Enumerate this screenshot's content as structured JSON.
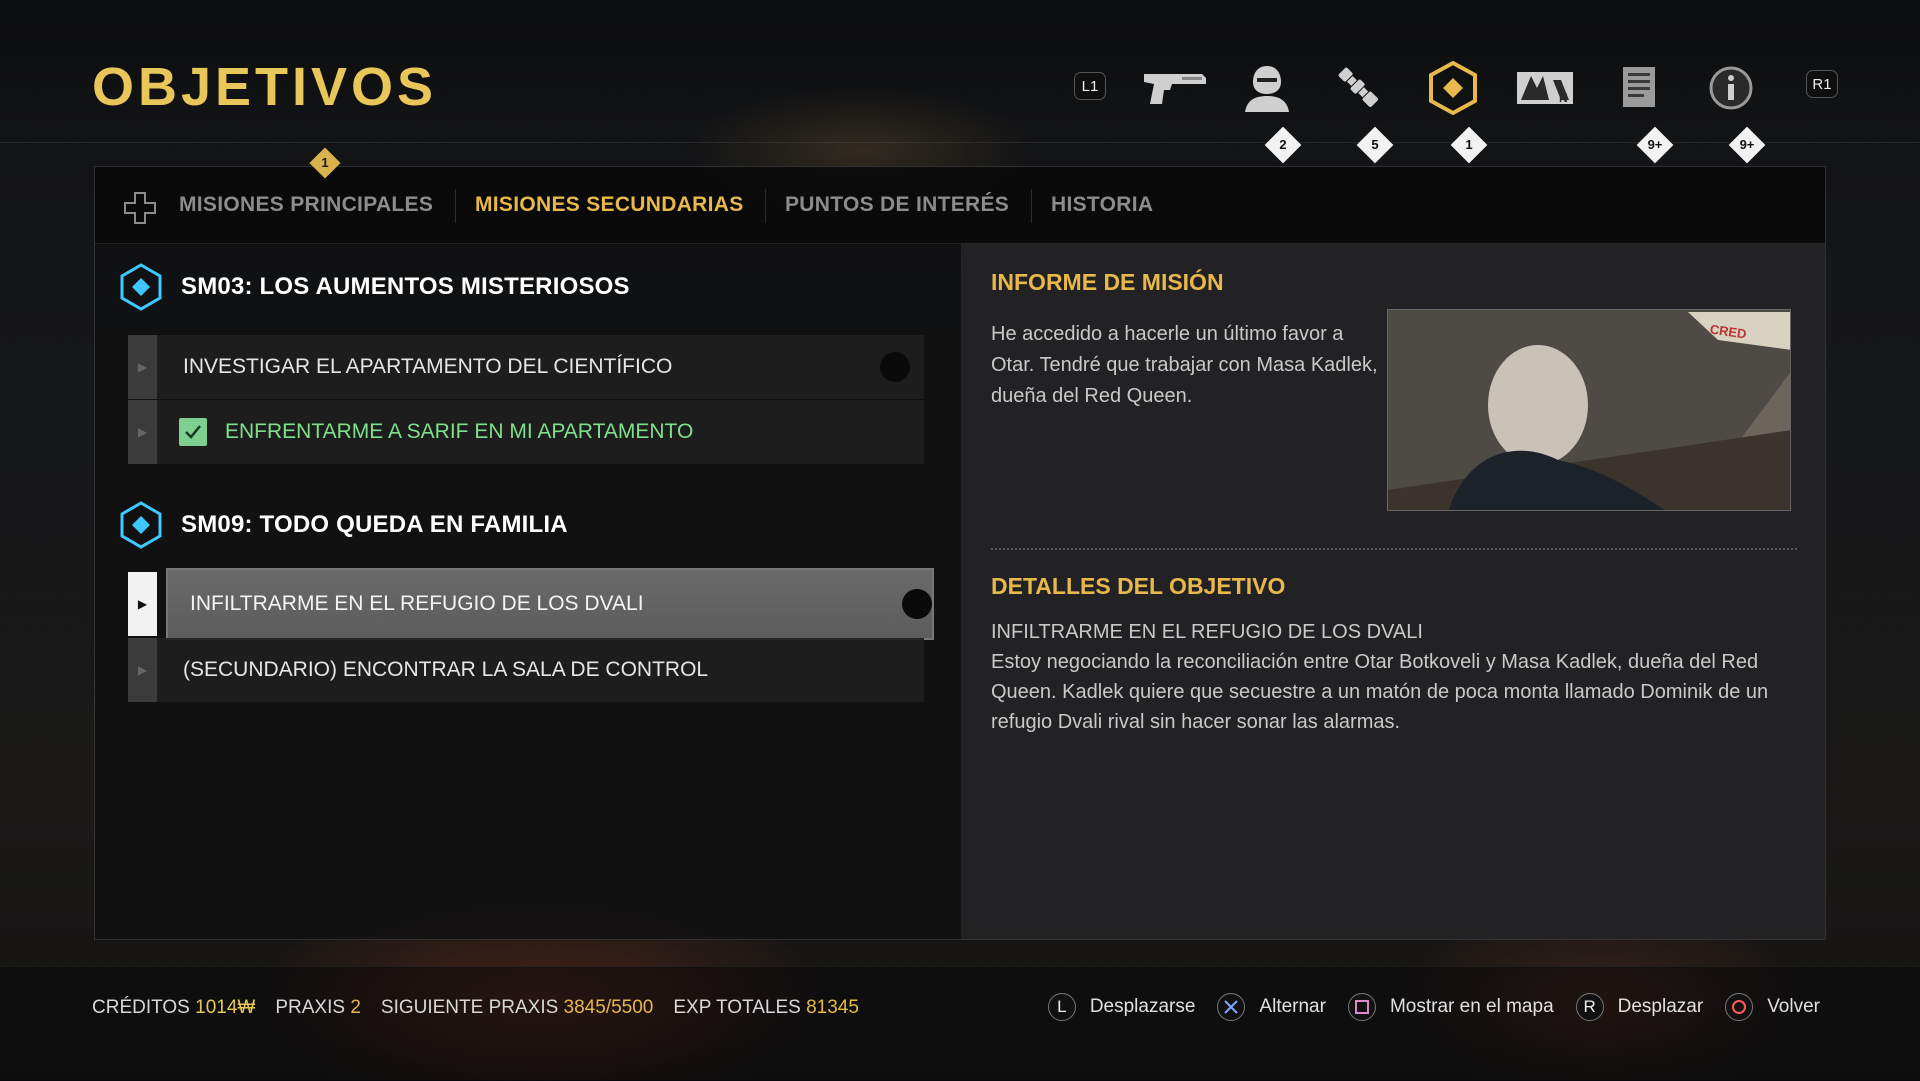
{
  "header": {
    "title": "OBJETIVOS"
  },
  "topnav": {
    "left_shoulder": "L1",
    "right_shoulder": "R1",
    "icons": [
      {
        "name": "weapon-pistol-icon",
        "badge": ""
      },
      {
        "name": "character-profile-icon",
        "badge": "2"
      },
      {
        "name": "augmentations-icon",
        "badge": "5"
      },
      {
        "name": "objectives-icon",
        "badge": "1",
        "active": true
      },
      {
        "name": "map-icon",
        "badge": ""
      },
      {
        "name": "database-icon",
        "badge": "9+"
      },
      {
        "name": "info-icon",
        "badge": "9+"
      }
    ]
  },
  "tabs": {
    "badge": "1",
    "items": [
      {
        "label": "MISIONES PRINCIPALES",
        "active": false
      },
      {
        "label": "MISIONES SECUNDARIAS",
        "active": true
      },
      {
        "label": "PUNTOS DE INTERÉS",
        "active": false
      },
      {
        "label": "HISTORIA",
        "active": false
      }
    ]
  },
  "missions": [
    {
      "title": "SM03: LOS AUMENTOS MISTERIOSOS",
      "objectives": [
        {
          "text": "INVESTIGAR EL APARTAMENTO DEL CIENTÍFICO",
          "status": "pending"
        },
        {
          "text": "ENFRENTARME A SARIF EN MI APARTAMENTO",
          "status": "done"
        }
      ]
    },
    {
      "title": "SM09: TODO QUEDA EN FAMILIA",
      "objectives": [
        {
          "text": "INFILTRARME EN EL REFUGIO DE LOS DVALI",
          "status": "selected"
        },
        {
          "text": "(SECUNDARIO) ENCONTRAR LA SALA DE CONTROL",
          "status": "optional"
        }
      ]
    }
  ],
  "briefing": {
    "title": "INFORME DE MISIÓN",
    "text": "He accedido a hacerle un último favor a Otar. Tendré que trabajar con Masa Kadlek, dueña del Red Queen.",
    "image_card_text": "CRED"
  },
  "details": {
    "title": "DETALLES DEL OBJETIVO",
    "objective": "INFILTRARME EN EL REFUGIO DE LOS DVALI",
    "text": "Estoy negociando la reconciliación entre Otar Botkoveli y Masa Kadlek, dueña del Red Queen. Kadlek quiere que secuestre a un matón de poca monta llamado Dominik de un refugio Dvali rival sin hacer sonar las alarmas."
  },
  "footer": {
    "credits_label": "CRÉDITOS",
    "credits_value": "1014₩",
    "praxis_label": "PRAXIS",
    "praxis_value": "2",
    "next_praxis_label": "SIGUIENTE PRAXIS",
    "next_praxis_value": "3845/5500",
    "total_exp_label": "EXP TOTALES",
    "total_exp_value": "81345",
    "hints": [
      {
        "button": "L",
        "label": "Desplazarse"
      },
      {
        "button": "cross",
        "label": "Alternar"
      },
      {
        "button": "square",
        "label": "Mostrar en el mapa"
      },
      {
        "button": "R",
        "label": "Desplazar"
      },
      {
        "button": "circle",
        "label": "Volver"
      }
    ]
  },
  "colors": {
    "accent": "#e8b84a",
    "title": "#e8c65a",
    "completed": "#7fe08a",
    "mission_icon": "#3ec8ff"
  }
}
